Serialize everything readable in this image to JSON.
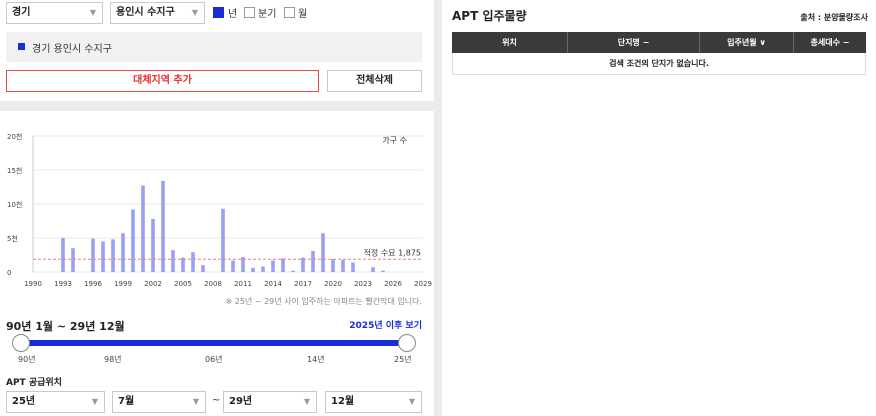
{
  "filters": {
    "province": "경기",
    "city": "용인시 수지구",
    "period_options": [
      {
        "label": "년",
        "checked": true
      },
      {
        "label": "분기",
        "checked": false
      },
      {
        "label": "월",
        "checked": false
      }
    ]
  },
  "selected_region": "경기 용인시 수지구",
  "buttons": {
    "add_region": "대체지역 추가",
    "delete_all": "전체삭제"
  },
  "chart_data": {
    "type": "bar",
    "legend": "가구 수",
    "x_ticks": [
      "1990",
      "1993",
      "1996",
      "1999",
      "2002",
      "2005",
      "2008",
      "2011",
      "2014",
      "2017",
      "2020",
      "2023",
      "2026",
      "2029"
    ],
    "y_ticks": [
      "0",
      "5천",
      "10천",
      "15천",
      "20천"
    ],
    "ylim": [
      0,
      20000
    ],
    "x": [
      1993,
      1994,
      1996,
      1997,
      1998,
      1999,
      2000,
      2001,
      2002,
      2003,
      2004,
      2005,
      2006,
      2007,
      2009,
      2010,
      2011,
      2012,
      2013,
      2014,
      2015,
      2016,
      2017,
      2018,
      2019,
      2020,
      2021,
      2022,
      2024,
      2025
    ],
    "values": [
      5000,
      3500,
      4900,
      4500,
      4800,
      5700,
      9200,
      12700,
      7800,
      13400,
      3200,
      2100,
      2900,
      1000,
      9300,
      1700,
      2200,
      600,
      800,
      1700,
      2000,
      200,
      2100,
      3100,
      5700,
      1900,
      1800,
      1400,
      700,
      200
    ],
    "reference_line": {
      "label": "적정 수요 1,875",
      "value": 1875
    }
  },
  "chart_note": "※ 25년 ~ 29년 사이 입주하는 아파트는 빨간막대 입니다.",
  "period_range": "90년 1월 ~ 29년 12월",
  "after_2025_link": "2025년 이후 보기",
  "slider": {
    "ticks": [
      "90년",
      "98년",
      "06년",
      "14년",
      "25년"
    ]
  },
  "supply_section": {
    "title": "APT 공급위치",
    "start_year": "25년",
    "start_month": "7월",
    "separator": "~",
    "end_year": "29년",
    "end_month": "12월"
  },
  "right_panel": {
    "title": "APT 입주물량",
    "source": "출처 : 분양물량조사",
    "columns": [
      "위치",
      "단지명 −",
      "입주년월 ∨",
      "총세대수 −"
    ],
    "empty_message": "검색 조건의 단지가 없습니다."
  },
  "colors": {
    "accent": "#1a2cd6",
    "bar": "#9aa0f2",
    "reference_line": "#f08080",
    "button_red": "#e0302f"
  }
}
